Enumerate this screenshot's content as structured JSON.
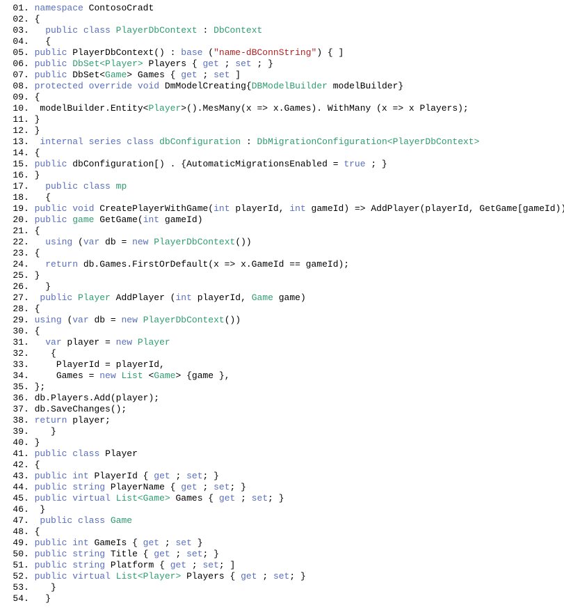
{
  "lines": [
    {
      "num": "01",
      "segs": [
        {
          "c": "tx",
          "t": " "
        },
        {
          "c": "kw",
          "t": "namespace"
        },
        {
          "c": "tx",
          "t": " ContosoCradt"
        }
      ]
    },
    {
      "num": "02",
      "segs": [
        {
          "c": "tx",
          "t": " {"
        }
      ]
    },
    {
      "num": "03",
      "segs": [
        {
          "c": "tx",
          "t": "   "
        },
        {
          "c": "kw",
          "t": "public"
        },
        {
          "c": "tx",
          "t": " "
        },
        {
          "c": "kw",
          "t": "class"
        },
        {
          "c": "tx",
          "t": " "
        },
        {
          "c": "ty",
          "t": "PlayerDbContext"
        },
        {
          "c": "tx",
          "t": " : "
        },
        {
          "c": "ty",
          "t": "DbContext"
        }
      ]
    },
    {
      "num": "04",
      "segs": [
        {
          "c": "tx",
          "t": "   {"
        }
      ]
    },
    {
      "num": "05",
      "segs": [
        {
          "c": "tx",
          "t": " "
        },
        {
          "c": "kw",
          "t": "public"
        },
        {
          "c": "tx",
          "t": " PlayerDbContext() : "
        },
        {
          "c": "kw",
          "t": "base"
        },
        {
          "c": "tx",
          "t": " ("
        },
        {
          "c": "st",
          "t": "\"name-dBConnString\""
        },
        {
          "c": "tx",
          "t": ") { ]"
        }
      ]
    },
    {
      "num": "06",
      "segs": [
        {
          "c": "tx",
          "t": " "
        },
        {
          "c": "kw",
          "t": "public"
        },
        {
          "c": "tx",
          "t": " "
        },
        {
          "c": "ty",
          "t": "DbSet<Player>"
        },
        {
          "c": "tx",
          "t": " Players { "
        },
        {
          "c": "kw",
          "t": "get"
        },
        {
          "c": "tx",
          "t": " ; "
        },
        {
          "c": "kw",
          "t": "set"
        },
        {
          "c": "tx",
          "t": " ; }"
        }
      ]
    },
    {
      "num": "07",
      "segs": [
        {
          "c": "tx",
          "t": " "
        },
        {
          "c": "kw",
          "t": "public"
        },
        {
          "c": "tx",
          "t": " DbSet<"
        },
        {
          "c": "ty",
          "t": "Game"
        },
        {
          "c": "tx",
          "t": "> Games { "
        },
        {
          "c": "kw",
          "t": "get"
        },
        {
          "c": "tx",
          "t": " ; "
        },
        {
          "c": "kw",
          "t": "set"
        },
        {
          "c": "tx",
          "t": " ]"
        }
      ]
    },
    {
      "num": "08",
      "segs": [
        {
          "c": "tx",
          "t": " "
        },
        {
          "c": "kw",
          "t": "protected"
        },
        {
          "c": "tx",
          "t": " "
        },
        {
          "c": "kw",
          "t": "override"
        },
        {
          "c": "tx",
          "t": " "
        },
        {
          "c": "kw",
          "t": "void"
        },
        {
          "c": "tx",
          "t": " DmModelCreating{"
        },
        {
          "c": "ty",
          "t": "DBModelBuilder"
        },
        {
          "c": "tx",
          "t": " modelBuilder}"
        }
      ]
    },
    {
      "num": "09",
      "segs": [
        {
          "c": "tx",
          "t": " {"
        }
      ]
    },
    {
      "num": "10",
      "segs": [
        {
          "c": "tx",
          "t": "  modelBuilder.Entity<"
        },
        {
          "c": "ty",
          "t": "Player"
        },
        {
          "c": "tx",
          "t": ">().MesMany(x => x.Games). WithMany (x => x Players);"
        }
      ]
    },
    {
      "num": "11",
      "segs": [
        {
          "c": "tx",
          "t": " }"
        }
      ]
    },
    {
      "num": "12",
      "segs": [
        {
          "c": "tx",
          "t": " }"
        }
      ]
    },
    {
      "num": "13",
      "segs": [
        {
          "c": "tx",
          "t": "  "
        },
        {
          "c": "kw",
          "t": "internal"
        },
        {
          "c": "tx",
          "t": " "
        },
        {
          "c": "kw",
          "t": "series"
        },
        {
          "c": "tx",
          "t": " "
        },
        {
          "c": "kw",
          "t": "class"
        },
        {
          "c": "tx",
          "t": " "
        },
        {
          "c": "ty",
          "t": "dbConfiguration"
        },
        {
          "c": "tx",
          "t": " : "
        },
        {
          "c": "ty",
          "t": "DbMigrationConfiguration<PlayerDbContext>"
        }
      ]
    },
    {
      "num": "14",
      "segs": [
        {
          "c": "tx",
          "t": " {"
        }
      ]
    },
    {
      "num": "15",
      "segs": [
        {
          "c": "tx",
          "t": " "
        },
        {
          "c": "kw",
          "t": "public"
        },
        {
          "c": "tx",
          "t": " dbConfiguration[) . {AutomaticMigrationsEnabled = "
        },
        {
          "c": "kw",
          "t": "true"
        },
        {
          "c": "tx",
          "t": " ; }"
        }
      ]
    },
    {
      "num": "16",
      "segs": [
        {
          "c": "tx",
          "t": " }"
        }
      ]
    },
    {
      "num": "17",
      "segs": [
        {
          "c": "tx",
          "t": "   "
        },
        {
          "c": "kw",
          "t": "public"
        },
        {
          "c": "tx",
          "t": " "
        },
        {
          "c": "kw",
          "t": "class"
        },
        {
          "c": "tx",
          "t": " "
        },
        {
          "c": "ty",
          "t": "mp"
        }
      ]
    },
    {
      "num": "18",
      "segs": [
        {
          "c": "tx",
          "t": "   {"
        }
      ]
    },
    {
      "num": "19",
      "segs": [
        {
          "c": "tx",
          "t": " "
        },
        {
          "c": "kw",
          "t": "public"
        },
        {
          "c": "tx",
          "t": " "
        },
        {
          "c": "kw",
          "t": "void"
        },
        {
          "c": "tx",
          "t": " CreatePlayerWithGame("
        },
        {
          "c": "kw",
          "t": "int"
        },
        {
          "c": "tx",
          "t": " playerId, "
        },
        {
          "c": "kw",
          "t": "int"
        },
        {
          "c": "tx",
          "t": " gameId) => AddPlayer(playerId, GetGame[gameId));"
        }
      ]
    },
    {
      "num": "20",
      "segs": [
        {
          "c": "tx",
          "t": " "
        },
        {
          "c": "kw",
          "t": "public"
        },
        {
          "c": "tx",
          "t": " "
        },
        {
          "c": "ty",
          "t": "game"
        },
        {
          "c": "tx",
          "t": " GetGame("
        },
        {
          "c": "kw",
          "t": "int"
        },
        {
          "c": "tx",
          "t": " gameId)"
        }
      ]
    },
    {
      "num": "21",
      "segs": [
        {
          "c": "tx",
          "t": " {"
        }
      ]
    },
    {
      "num": "22",
      "segs": [
        {
          "c": "tx",
          "t": "   "
        },
        {
          "c": "kw",
          "t": "using"
        },
        {
          "c": "tx",
          "t": " ("
        },
        {
          "c": "kw",
          "t": "var"
        },
        {
          "c": "tx",
          "t": " db = "
        },
        {
          "c": "kw",
          "t": "new"
        },
        {
          "c": "tx",
          "t": " "
        },
        {
          "c": "ty",
          "t": "PlayerDbContext"
        },
        {
          "c": "tx",
          "t": "())"
        }
      ]
    },
    {
      "num": "23",
      "segs": [
        {
          "c": "tx",
          "t": " {"
        }
      ]
    },
    {
      "num": "24",
      "segs": [
        {
          "c": "tx",
          "t": "   "
        },
        {
          "c": "kw",
          "t": "return"
        },
        {
          "c": "tx",
          "t": " db.Games.FirstOrDefault(x => x.GameId == gameId);"
        }
      ]
    },
    {
      "num": "25",
      "segs": [
        {
          "c": "tx",
          "t": " }"
        }
      ]
    },
    {
      "num": "26",
      "segs": [
        {
          "c": "tx",
          "t": "   }"
        }
      ]
    },
    {
      "num": "27",
      "segs": [
        {
          "c": "tx",
          "t": "  "
        },
        {
          "c": "kw",
          "t": "public"
        },
        {
          "c": "tx",
          "t": " "
        },
        {
          "c": "ty",
          "t": "Player"
        },
        {
          "c": "tx",
          "t": " AddPlayer ("
        },
        {
          "c": "kw",
          "t": "int"
        },
        {
          "c": "tx",
          "t": " playerId, "
        },
        {
          "c": "ty",
          "t": "Game"
        },
        {
          "c": "tx",
          "t": " game)"
        }
      ]
    },
    {
      "num": "28",
      "segs": [
        {
          "c": "tx",
          "t": " {"
        }
      ]
    },
    {
      "num": "29",
      "segs": [
        {
          "c": "tx",
          "t": " "
        },
        {
          "c": "kw",
          "t": "using"
        },
        {
          "c": "tx",
          "t": " ("
        },
        {
          "c": "kw",
          "t": "var"
        },
        {
          "c": "tx",
          "t": " db = "
        },
        {
          "c": "kw",
          "t": "new"
        },
        {
          "c": "tx",
          "t": " "
        },
        {
          "c": "ty",
          "t": "PlayerDbContext"
        },
        {
          "c": "tx",
          "t": "())"
        }
      ]
    },
    {
      "num": "30",
      "segs": [
        {
          "c": "tx",
          "t": " {"
        }
      ]
    },
    {
      "num": "31",
      "segs": [
        {
          "c": "tx",
          "t": "   "
        },
        {
          "c": "kw",
          "t": "var"
        },
        {
          "c": "tx",
          "t": " player = "
        },
        {
          "c": "kw",
          "t": "new"
        },
        {
          "c": "tx",
          "t": " "
        },
        {
          "c": "ty",
          "t": "Player"
        }
      ]
    },
    {
      "num": "32",
      "segs": [
        {
          "c": "tx",
          "t": "    {"
        }
      ]
    },
    {
      "num": "33",
      "segs": [
        {
          "c": "tx",
          "t": "     PlayerId = playerId,"
        }
      ]
    },
    {
      "num": "34",
      "segs": [
        {
          "c": "tx",
          "t": "     Games = "
        },
        {
          "c": "kw",
          "t": "new"
        },
        {
          "c": "tx",
          "t": " "
        },
        {
          "c": "ty",
          "t": "List"
        },
        {
          "c": "tx",
          "t": " <"
        },
        {
          "c": "ty",
          "t": "Game"
        },
        {
          "c": "tx",
          "t": "> {game },"
        }
      ]
    },
    {
      "num": "35",
      "segs": [
        {
          "c": "tx",
          "t": " };"
        }
      ]
    },
    {
      "num": "36",
      "segs": [
        {
          "c": "tx",
          "t": " db.Players.Add(player);"
        }
      ]
    },
    {
      "num": "37",
      "segs": [
        {
          "c": "tx",
          "t": " db.SaveChanges();"
        }
      ]
    },
    {
      "num": "38",
      "segs": [
        {
          "c": "tx",
          "t": " "
        },
        {
          "c": "kw",
          "t": "return"
        },
        {
          "c": "tx",
          "t": " player;"
        }
      ]
    },
    {
      "num": "39",
      "segs": [
        {
          "c": "tx",
          "t": "    }"
        }
      ]
    },
    {
      "num": "40",
      "segs": [
        {
          "c": "tx",
          "t": " }"
        }
      ]
    },
    {
      "num": "41",
      "segs": [
        {
          "c": "tx",
          "t": " "
        },
        {
          "c": "kw",
          "t": "public"
        },
        {
          "c": "tx",
          "t": " "
        },
        {
          "c": "kw",
          "t": "class"
        },
        {
          "c": "tx",
          "t": " Player"
        }
      ]
    },
    {
      "num": "42",
      "segs": [
        {
          "c": "tx",
          "t": " {"
        }
      ]
    },
    {
      "num": "43",
      "segs": [
        {
          "c": "tx",
          "t": " "
        },
        {
          "c": "kw",
          "t": "public"
        },
        {
          "c": "tx",
          "t": " "
        },
        {
          "c": "kw",
          "t": "int"
        },
        {
          "c": "tx",
          "t": " PlayerId { "
        },
        {
          "c": "kw",
          "t": "get"
        },
        {
          "c": "tx",
          "t": " ; "
        },
        {
          "c": "kw",
          "t": "set"
        },
        {
          "c": "tx",
          "t": "; }"
        }
      ]
    },
    {
      "num": "44",
      "segs": [
        {
          "c": "tx",
          "t": " "
        },
        {
          "c": "kw",
          "t": "public"
        },
        {
          "c": "tx",
          "t": " "
        },
        {
          "c": "kw",
          "t": "string"
        },
        {
          "c": "tx",
          "t": " PlayerName { "
        },
        {
          "c": "kw",
          "t": "get"
        },
        {
          "c": "tx",
          "t": " ; "
        },
        {
          "c": "kw",
          "t": "set"
        },
        {
          "c": "tx",
          "t": "; }"
        }
      ]
    },
    {
      "num": "45",
      "segs": [
        {
          "c": "tx",
          "t": " "
        },
        {
          "c": "kw",
          "t": "public"
        },
        {
          "c": "tx",
          "t": " "
        },
        {
          "c": "kw",
          "t": "virtual"
        },
        {
          "c": "tx",
          "t": " "
        },
        {
          "c": "ty",
          "t": "List<Game>"
        },
        {
          "c": "tx",
          "t": " Games { "
        },
        {
          "c": "kw",
          "t": "get"
        },
        {
          "c": "tx",
          "t": " ; "
        },
        {
          "c": "kw",
          "t": "set"
        },
        {
          "c": "tx",
          "t": "; }"
        }
      ]
    },
    {
      "num": "46",
      "segs": [
        {
          "c": "tx",
          "t": "  }"
        }
      ]
    },
    {
      "num": "47",
      "segs": [
        {
          "c": "tx",
          "t": "  "
        },
        {
          "c": "kw",
          "t": "public"
        },
        {
          "c": "tx",
          "t": " "
        },
        {
          "c": "kw",
          "t": "class"
        },
        {
          "c": "tx",
          "t": " "
        },
        {
          "c": "ty",
          "t": "Game"
        }
      ]
    },
    {
      "num": "48",
      "segs": [
        {
          "c": "tx",
          "t": " {"
        }
      ]
    },
    {
      "num": "49",
      "segs": [
        {
          "c": "tx",
          "t": " "
        },
        {
          "c": "kw",
          "t": "public"
        },
        {
          "c": "tx",
          "t": " "
        },
        {
          "c": "kw",
          "t": "int"
        },
        {
          "c": "tx",
          "t": " GameIs { "
        },
        {
          "c": "kw",
          "t": "get"
        },
        {
          "c": "tx",
          "t": " ; "
        },
        {
          "c": "kw",
          "t": "set"
        },
        {
          "c": "tx",
          "t": " }"
        }
      ]
    },
    {
      "num": "50",
      "segs": [
        {
          "c": "tx",
          "t": " "
        },
        {
          "c": "kw",
          "t": "public"
        },
        {
          "c": "tx",
          "t": " "
        },
        {
          "c": "kw",
          "t": "string"
        },
        {
          "c": "tx",
          "t": " Title { "
        },
        {
          "c": "kw",
          "t": "get"
        },
        {
          "c": "tx",
          "t": " ; "
        },
        {
          "c": "kw",
          "t": "set"
        },
        {
          "c": "tx",
          "t": "; }"
        }
      ]
    },
    {
      "num": "51",
      "segs": [
        {
          "c": "tx",
          "t": " "
        },
        {
          "c": "kw",
          "t": "public"
        },
        {
          "c": "tx",
          "t": " "
        },
        {
          "c": "kw",
          "t": "string"
        },
        {
          "c": "tx",
          "t": " Platform { "
        },
        {
          "c": "kw",
          "t": "get"
        },
        {
          "c": "tx",
          "t": " ; "
        },
        {
          "c": "kw",
          "t": "set"
        },
        {
          "c": "tx",
          "t": "; ]"
        }
      ]
    },
    {
      "num": "52",
      "segs": [
        {
          "c": "tx",
          "t": " "
        },
        {
          "c": "kw",
          "t": "public"
        },
        {
          "c": "tx",
          "t": " "
        },
        {
          "c": "kw",
          "t": "virtual"
        },
        {
          "c": "tx",
          "t": " "
        },
        {
          "c": "ty",
          "t": "List<Player>"
        },
        {
          "c": "tx",
          "t": " Players { "
        },
        {
          "c": "kw",
          "t": "get"
        },
        {
          "c": "tx",
          "t": " ; "
        },
        {
          "c": "kw",
          "t": "set"
        },
        {
          "c": "tx",
          "t": "; }"
        }
      ]
    },
    {
      "num": "53",
      "segs": [
        {
          "c": "tx",
          "t": "    }"
        }
      ]
    },
    {
      "num": "54",
      "segs": [
        {
          "c": "tx",
          "t": "   }"
        }
      ]
    }
  ]
}
